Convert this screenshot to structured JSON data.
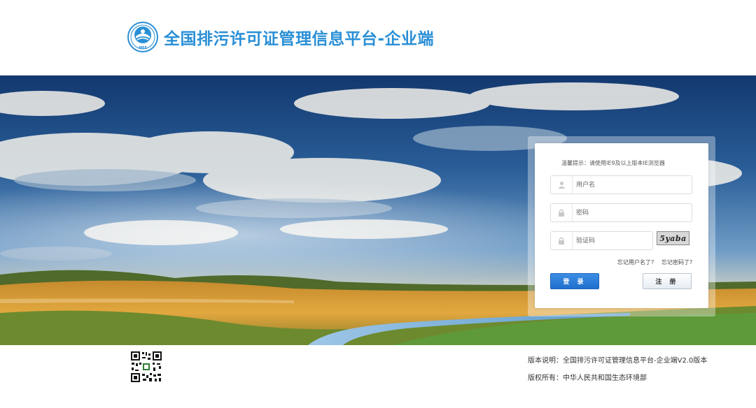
{
  "header": {
    "title": "全国排污许可证管理信息平台-企业端",
    "logo_icon": "mee-emblem-icon",
    "logo_text": "MEE",
    "brand_color": "#2a8fd6"
  },
  "login": {
    "tip": "温馨提示：请使用IE9及以上版本IE浏览器",
    "username": {
      "placeholder": "用户名",
      "icon": "user-icon"
    },
    "password": {
      "placeholder": "密码",
      "icon": "lock-icon"
    },
    "captcha_field": {
      "placeholder": "验证码",
      "icon": "lock-icon"
    },
    "captcha_text": "5yaba",
    "forgot_username": "忘记用户名了?",
    "forgot_password": "忘记密码了?",
    "login_button": "登 录",
    "register_button": "注 册",
    "accent_color": "#2a7fdc"
  },
  "footer": {
    "version": "版本说明：全国排污许可证管理信息平台-企业端V2.0版本",
    "copyright": "版权所有：中华人民共和国生态环境部",
    "qr_icon": "qr-code-icon"
  }
}
